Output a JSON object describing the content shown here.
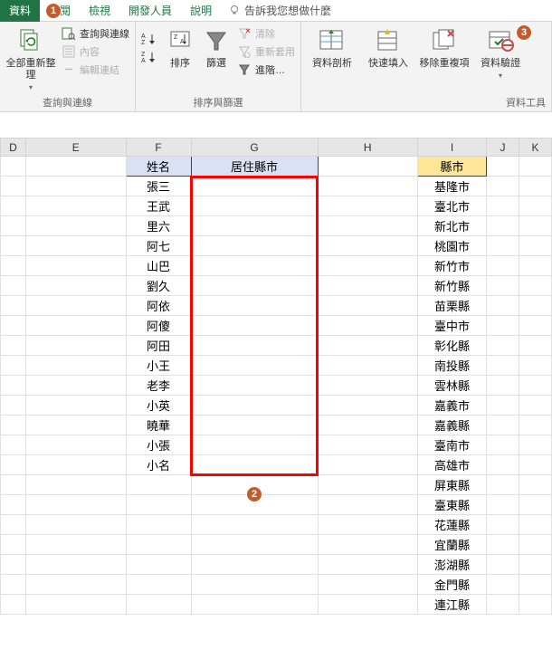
{
  "tabs": {
    "data": "資料",
    "review": "校閱",
    "view": "檢視",
    "developer": "開發人員",
    "help": "說明",
    "tell_me": "告訴我您想做什麼"
  },
  "ribbon": {
    "refresh": "全部重新整理",
    "queries": "查詢與連線",
    "conn": "查詢與連線",
    "props": "內容",
    "edit_links": "編輯連結",
    "sort": "排序",
    "filter": "篩選",
    "sort_filter": "排序與篩選",
    "clear": "清除",
    "reapply": "重新套用",
    "advanced": "進階…",
    "text_to_cols": "資料剖析",
    "flash_fill": "快速填入",
    "remove_dup": "移除重複項",
    "data_val": "資料驗證",
    "data_tools": "資料工具"
  },
  "headers": {
    "name": "姓名",
    "live_county": "居住縣市",
    "county": "縣市"
  },
  "names": [
    "張三",
    "王武",
    "里六",
    "阿七",
    "山巴",
    "劉久",
    "阿依",
    "阿傻",
    "阿田",
    "小王",
    "老李",
    "小英",
    "曉華",
    "小張",
    "小名"
  ],
  "counties": [
    "基隆市",
    "臺北市",
    "新北市",
    "桃園市",
    "新竹市",
    "新竹縣",
    "苗栗縣",
    "臺中市",
    "彰化縣",
    "南投縣",
    "雲林縣",
    "嘉義市",
    "嘉義縣",
    "臺南市",
    "高雄市",
    "屏東縣",
    "臺東縣",
    "花蓮縣",
    "宜蘭縣",
    "澎湖縣",
    "金門縣",
    "連江縣"
  ],
  "callouts": {
    "c1": "1",
    "c2": "2",
    "c3": "3"
  }
}
